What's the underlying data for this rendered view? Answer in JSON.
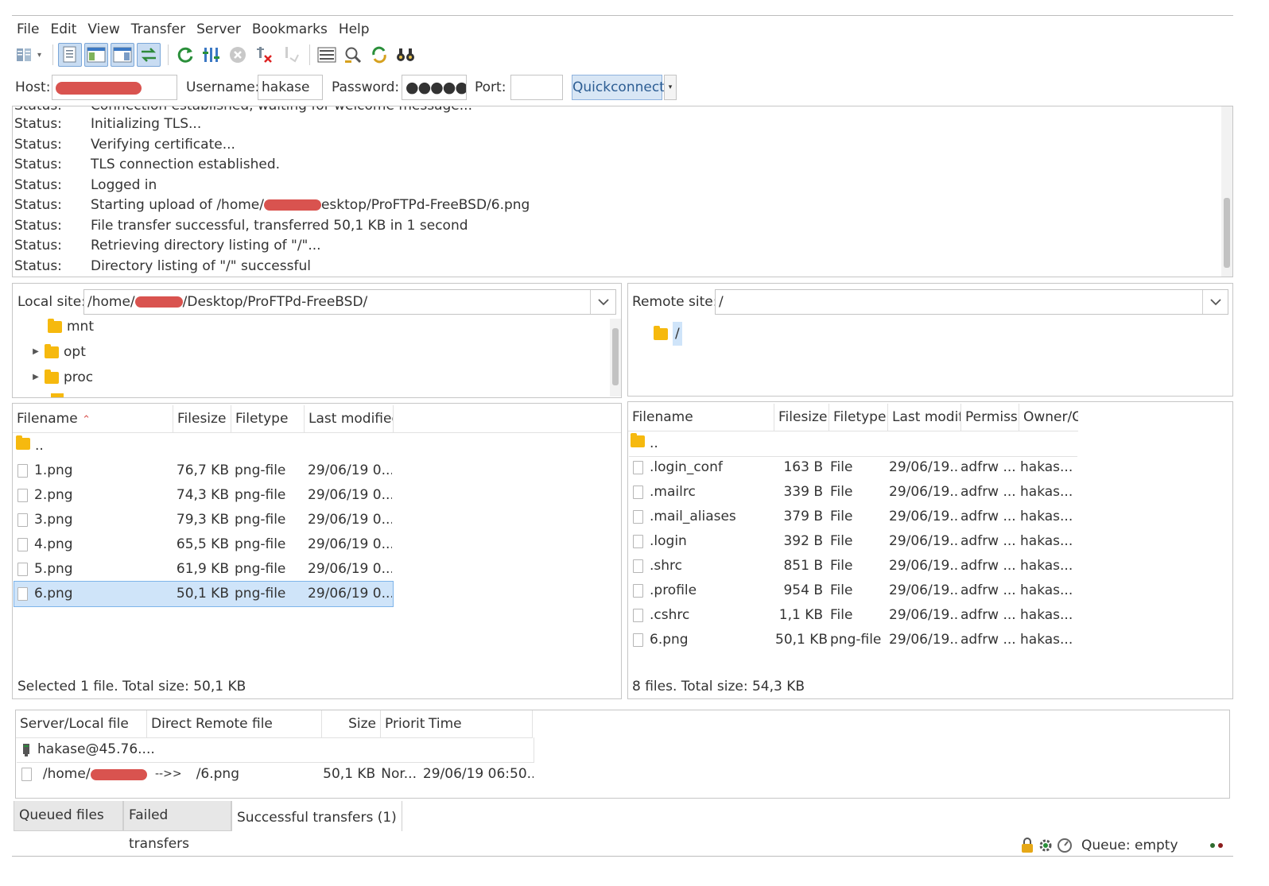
{
  "menu": [
    "File",
    "Edit",
    "View",
    "Transfer",
    "Server",
    "Bookmarks",
    "Help"
  ],
  "quickconnect": {
    "host_label": "Host:",
    "username_label": "Username:",
    "username_value": "hakase",
    "password_label": "Password:",
    "password_value": "●●●●●",
    "port_label": "Port:",
    "port_value": "",
    "button": "Quickconnect",
    "dropdown": "▾"
  },
  "log": [
    {
      "k": "Status:",
      "v": "Initializing TLS..."
    },
    {
      "k": "Status:",
      "v": "Verifying certificate..."
    },
    {
      "k": "Status:",
      "v": "TLS connection established."
    },
    {
      "k": "Status:",
      "v": "Logged in"
    },
    {
      "k": "Status:",
      "v": "Starting upload of /home/",
      "v2": "esktop/ProFTPd-FreeBSD/6.png"
    },
    {
      "k": "Status:",
      "v": "File transfer successful, transferred 50,1 KB in 1 second"
    },
    {
      "k": "Status:",
      "v": "Retrieving directory listing of \"/\"..."
    },
    {
      "k": "Status:",
      "v": "Directory listing of \"/\" successful"
    }
  ],
  "local": {
    "label": "Local site:",
    "path_a": "/home/",
    "path_b": "/Desktop/ProFTPd-FreeBSD/",
    "tree": [
      "mnt",
      "opt",
      "proc"
    ],
    "headers": [
      "Filename",
      "Filesize",
      "Filetype",
      "Last modified"
    ],
    "parent": "..",
    "files": [
      {
        "name": "1.png",
        "size": "76,7 KB",
        "type": "png-file",
        "modified": "29/06/19 0..."
      },
      {
        "name": "2.png",
        "size": "74,3 KB",
        "type": "png-file",
        "modified": "29/06/19 0..."
      },
      {
        "name": "3.png",
        "size": "79,3 KB",
        "type": "png-file",
        "modified": "29/06/19 0..."
      },
      {
        "name": "4.png",
        "size": "65,5 KB",
        "type": "png-file",
        "modified": "29/06/19 0..."
      },
      {
        "name": "5.png",
        "size": "61,9 KB",
        "type": "png-file",
        "modified": "29/06/19 0..."
      },
      {
        "name": "6.png",
        "size": "50,1 KB",
        "type": "png-file",
        "modified": "29/06/19 0..."
      }
    ],
    "status": "Selected 1 file. Total size: 50,1 KB"
  },
  "remote": {
    "label": "Remote site:",
    "path": "/",
    "tree_root": "/",
    "headers": [
      "Filename",
      "Filesize",
      "Filetype",
      "Last modifi",
      "Permissi",
      "Owner/G"
    ],
    "parent": "..",
    "files": [
      {
        "name": ".login_conf",
        "size": "163 B",
        "type": "File",
        "modified": "29/06/19...",
        "perm": "adfrw ...",
        "owner": "hakas..."
      },
      {
        "name": ".mailrc",
        "size": "339 B",
        "type": "File",
        "modified": "29/06/19...",
        "perm": "adfrw ...",
        "owner": "hakas..."
      },
      {
        "name": ".mail_aliases",
        "size": "379 B",
        "type": "File",
        "modified": "29/06/19...",
        "perm": "adfrw ...",
        "owner": "hakas..."
      },
      {
        "name": ".login",
        "size": "392 B",
        "type": "File",
        "modified": "29/06/19...",
        "perm": "adfrw ...",
        "owner": "hakas..."
      },
      {
        "name": ".shrc",
        "size": "851 B",
        "type": "File",
        "modified": "29/06/19...",
        "perm": "adfrw ...",
        "owner": "hakas..."
      },
      {
        "name": ".profile",
        "size": "954 B",
        "type": "File",
        "modified": "29/06/19...",
        "perm": "adfrw ...",
        "owner": "hakas..."
      },
      {
        "name": ".cshrc",
        "size": "1,1 KB",
        "type": "File",
        "modified": "29/06/19...",
        "perm": "adfrw ...",
        "owner": "hakas..."
      },
      {
        "name": "6.png",
        "size": "50,1 KB",
        "type": "png-file",
        "modified": "29/06/19...",
        "perm": "adfrw ...",
        "owner": "hakas..."
      }
    ],
    "status": "8 files. Total size: 54,3 KB"
  },
  "queue": {
    "headers": [
      "Server/Local file",
      "Directi",
      "Remote file",
      "Size",
      "Priorit",
      "Time"
    ],
    "server": "hakase@45.76....",
    "item": {
      "local": "/home/",
      "direction": "-->>",
      "remote": "/6.png",
      "size": "50,1 KB",
      "priority": "Nor...",
      "time": "29/06/19 06:50..."
    }
  },
  "tabs": [
    "Queued files",
    "Failed transfers",
    "Successful transfers (1)"
  ],
  "statusbar": {
    "queue": "Queue: empty"
  },
  "colors": {
    "accent": "#3b78c4",
    "selection": "#cfe4f9",
    "folder": "#f6b90e",
    "redaction": "#d9534f"
  }
}
